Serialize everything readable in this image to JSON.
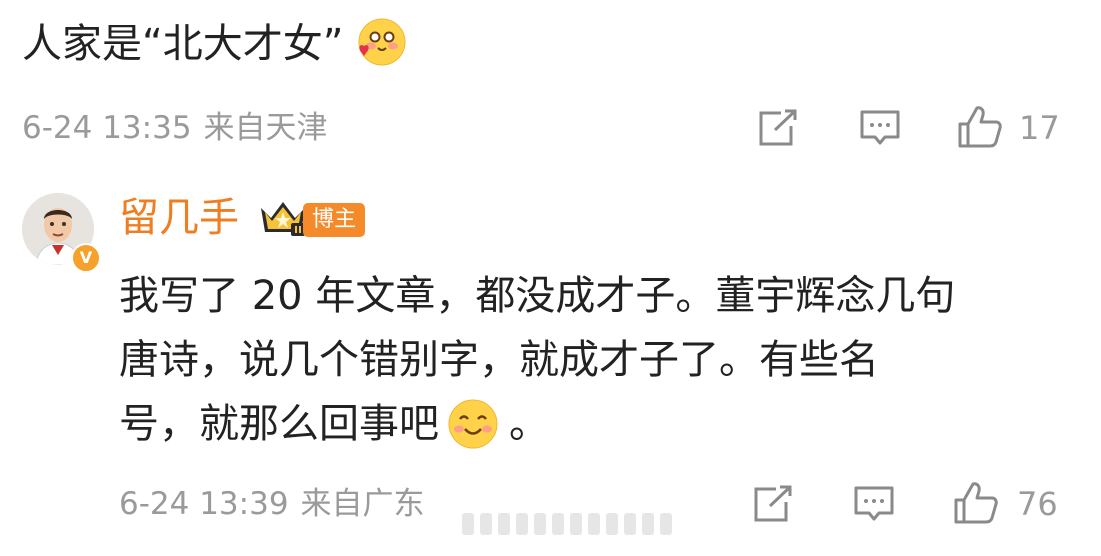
{
  "top_comment": {
    "text": "人家是“北大才女”",
    "emoji_icon": "blush-heart-emoji",
    "date": "6-24 13:35",
    "location": "来自天津",
    "like_count": "17"
  },
  "reply": {
    "username": "留几手",
    "username_color": "#ef7d22",
    "badge_label": "博主",
    "verified_mark": "V",
    "lines": [
      "我写了 20 年文章，都没成才子。董宇辉念几句",
      "唐诗，说几个错别字，就成才子了。有些名",
      "号，就那么回事吧"
    ],
    "line3_tail": "。",
    "emoji_icon": "smile-emoji",
    "date": "6-24 13:39",
    "location": "来自广东",
    "like_count": "76"
  }
}
